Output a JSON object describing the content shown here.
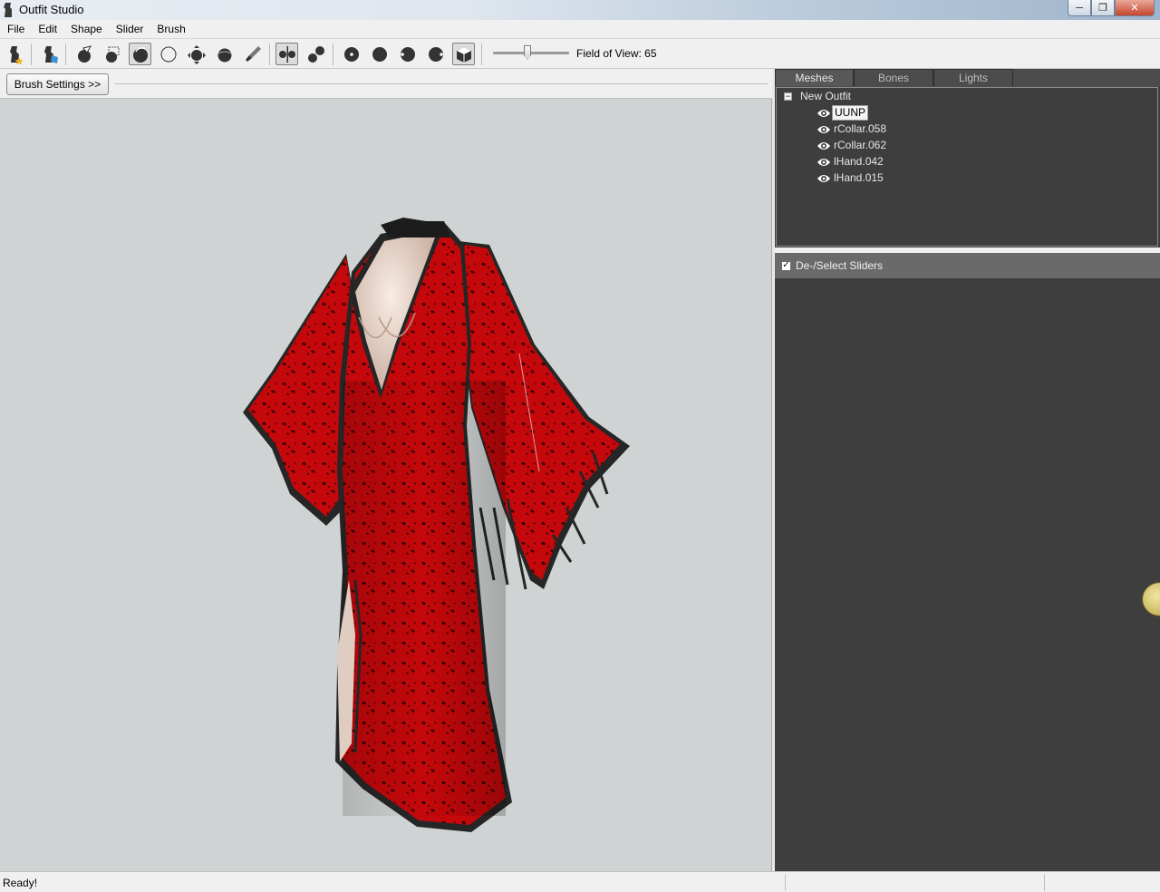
{
  "window": {
    "title": "Outfit Studio",
    "icon": "outfit-studio-app-icon",
    "controls": [
      "minimize",
      "maximize",
      "close"
    ]
  },
  "menu": [
    {
      "label": "File"
    },
    {
      "label": "Edit"
    },
    {
      "label": "Shape"
    },
    {
      "label": "Slider"
    },
    {
      "label": "Brush"
    }
  ],
  "toolbar": {
    "tools": [
      "load-reference-icon",
      "load-outfit-icon",
      "select-brush-icon",
      "mask-brush-icon",
      "inflate-brush-icon",
      "deflate-brush-icon",
      "move-brush-icon",
      "smooth-brush-icon",
      "weight-brush-icon",
      "mirror-x-icon",
      "connected-only-icon",
      "view-front-icon",
      "view-back-icon",
      "view-left-icon",
      "view-right-icon",
      "perspective-icon"
    ],
    "fov_label": "Field of View: 65",
    "fov_value": 65
  },
  "brush": {
    "settings_label": "Brush Settings >>"
  },
  "panel": {
    "tabs": [
      {
        "label": "Meshes",
        "active": true
      },
      {
        "label": "Bones",
        "active": false
      },
      {
        "label": "Lights",
        "active": false
      }
    ],
    "tree": {
      "root": "New Outfit",
      "items": [
        {
          "label": "UUNP",
          "selected": true
        },
        {
          "label": "rCollar.058",
          "selected": false
        },
        {
          "label": "rCollar.062",
          "selected": false
        },
        {
          "label": "lHand.042",
          "selected": false
        },
        {
          "label": "lHand.015",
          "selected": false
        }
      ]
    },
    "sliders_header": "De-/Select Sliders",
    "sliders_checked": true
  },
  "status": {
    "text": "Ready!"
  },
  "colors": {
    "viewport_bg": "#d0d3d3",
    "panel_bg": "#3e3e3e",
    "dress_red": "#c4080b",
    "trim_dark": "#262626",
    "skin": "#e9d7cb"
  }
}
